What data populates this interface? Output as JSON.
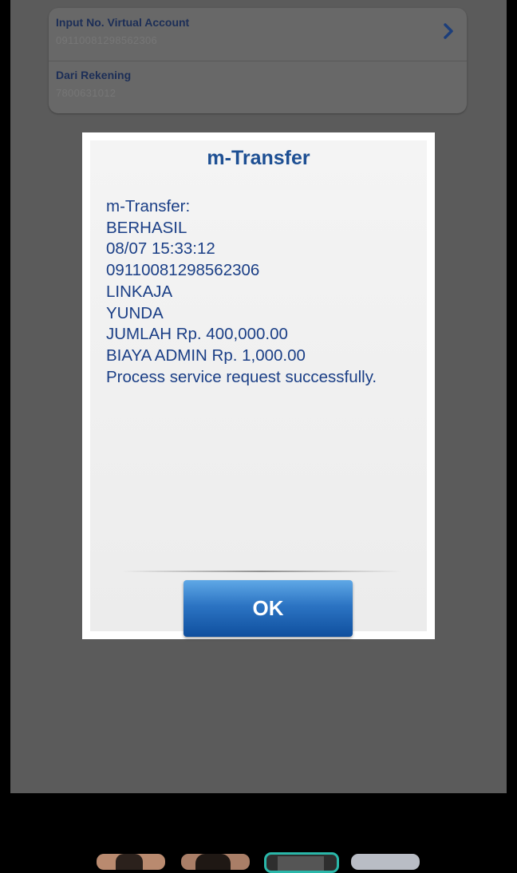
{
  "form": {
    "va_label": "Input No. Virtual Account",
    "va_value": "09110081298562306",
    "from_label": "Dari Rekening",
    "from_value": "7800631012"
  },
  "dialog": {
    "title": "m-Transfer",
    "lines": [
      "m-Transfer:",
      "BERHASIL",
      "08/07 15:33:12",
      "09110081298562306",
      "LINKAJA",
      "YUNDA",
      "JUMLAH Rp. 400,000.00",
      "BIAYA ADMIN Rp. 1,000.00",
      "Process service request successfully."
    ],
    "ok_label": "OK"
  },
  "icons": {
    "chevron": "chevron-right-icon"
  },
  "colors": {
    "accent": "#1d4f93",
    "button": "#2c74c3",
    "overlay": "#5b5b5b",
    "selected_thumb_border": "#2ab7a9"
  }
}
